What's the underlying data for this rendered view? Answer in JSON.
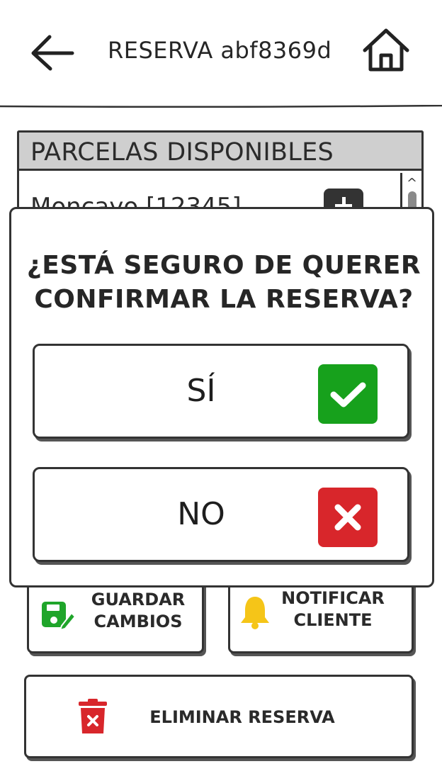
{
  "header": {
    "title": "RESERVA abf8369d",
    "back_icon": "arrow-left-icon",
    "home_icon": "home-icon"
  },
  "parcelas": {
    "title": "PARCELAS DISPONIBLES",
    "items": [
      {
        "label": "Moncayo   [12345]"
      }
    ]
  },
  "dialog": {
    "question": "¿ESTÁ SEGURO DE QUERER\nCONFIRMAR LA RESERVA?",
    "yes_label": "SÍ",
    "no_label": "NO"
  },
  "actions": {
    "save_label": "GUARDAR\nCAMBIOS",
    "notify_label": "NOTIFICAR\nCLIENTE",
    "delete_label": "ELIMINAR RESERVA"
  },
  "colors": {
    "confirm_green": "#17a11c",
    "cancel_red": "#d8262b",
    "save_icon_green": "#1fa52a",
    "bell_yellow": "#f5c518",
    "trash_red": "#d8262b",
    "panel_header_gray": "#cfcfcf"
  }
}
